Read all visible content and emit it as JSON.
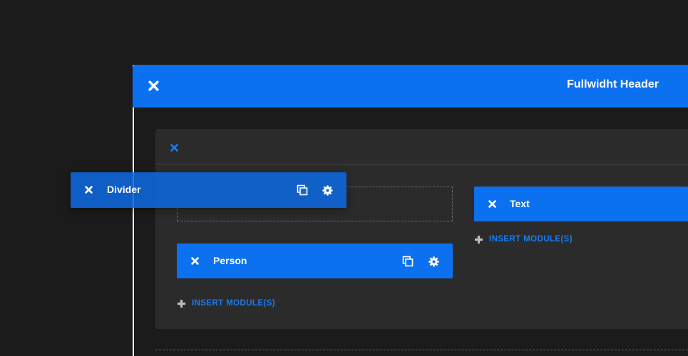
{
  "section": {
    "title": "Fullwidht Header"
  },
  "modules": {
    "divider": {
      "label": "Divider"
    },
    "person": {
      "label": "Person"
    },
    "text": {
      "label": "Text"
    }
  },
  "insert_modules": {
    "left": "INSERT MODULE(S)",
    "right": "INSERT MODULE(S)"
  },
  "colors": {
    "accent": "#0c71f0",
    "row_bg": "#2b2b2b",
    "page_bg": "#1b1b1b"
  },
  "icons": {
    "close": "close-icon",
    "duplicate": "duplicate-icon",
    "settings": "gear-icon",
    "plus": "plus-icon"
  }
}
